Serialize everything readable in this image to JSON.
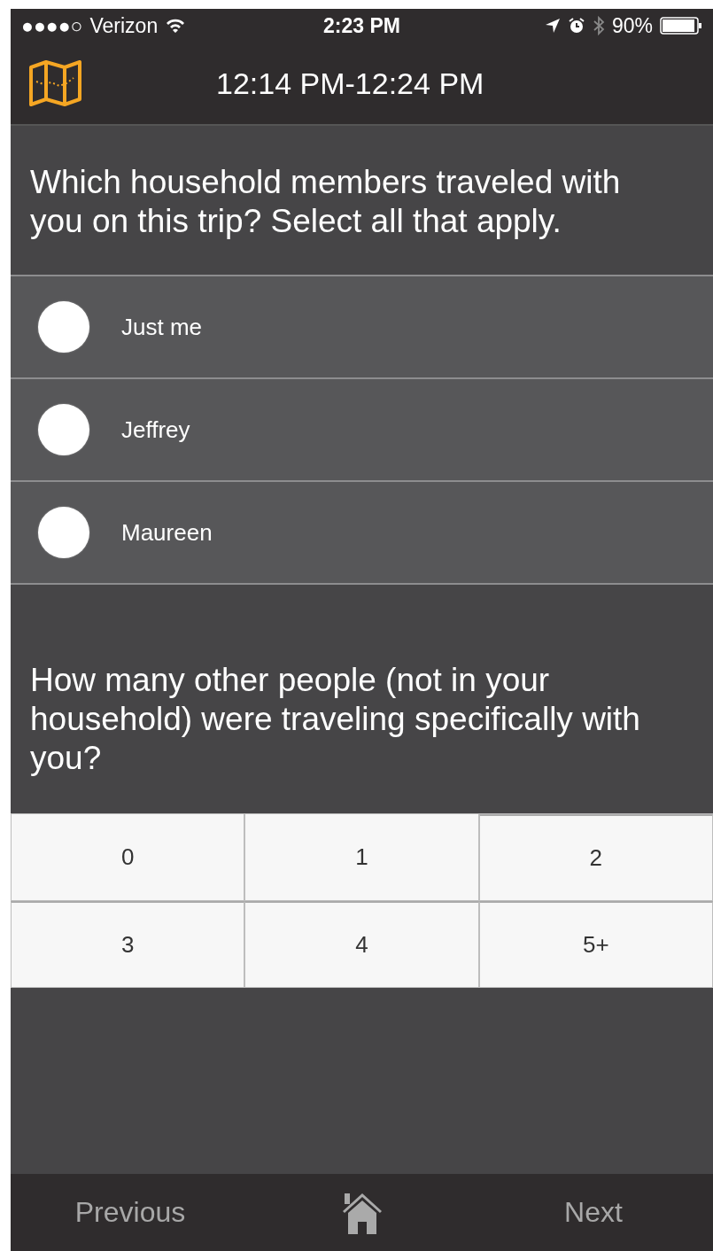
{
  "status_bar": {
    "signal_dots": "●●●●○",
    "carrier": "Verizon",
    "time": "2:23 PM",
    "battery": "90%"
  },
  "header": {
    "title": "12:14 PM-12:24 PM"
  },
  "question_1": {
    "text": "Which household members traveled with you on this trip? Select all that apply.",
    "options": [
      {
        "label": "Just me",
        "checked": false
      },
      {
        "label": "Jeffrey",
        "checked": false
      },
      {
        "label": "Maureen",
        "checked": false
      }
    ]
  },
  "question_2": {
    "text": "How many other people (not in your household) were traveling specifically with you?",
    "choices": [
      {
        "label": "0",
        "selected": false
      },
      {
        "label": "1",
        "selected": false
      },
      {
        "label": "2",
        "selected": false
      },
      {
        "label": "3",
        "selected": false
      },
      {
        "label": "4",
        "selected": false
      },
      {
        "label": "5+",
        "selected": false
      }
    ]
  },
  "bottom_bar": {
    "previous": "Previous",
    "next": "Next"
  }
}
